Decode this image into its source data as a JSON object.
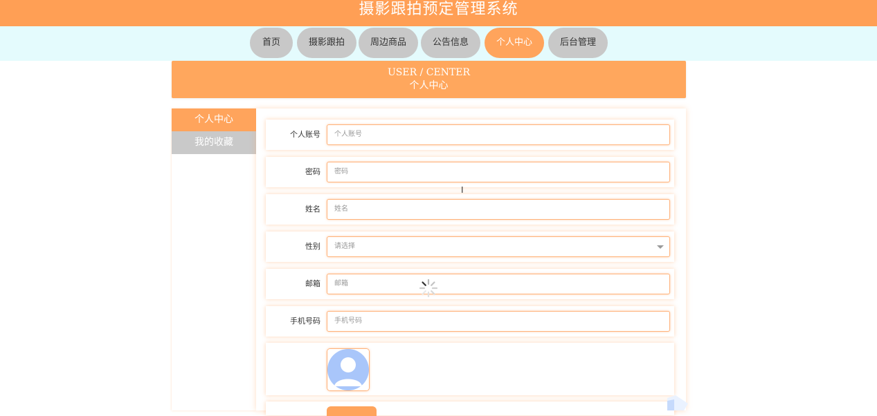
{
  "header": {
    "site_title": "摄影跟拍预定管理系统"
  },
  "nav": {
    "items": [
      {
        "label": "首页",
        "active": false
      },
      {
        "label": "摄影跟拍",
        "active": false
      },
      {
        "label": "周边商品",
        "active": false
      },
      {
        "label": "公告信息",
        "active": false
      },
      {
        "label": "个人中心",
        "active": true
      },
      {
        "label": "后台管理",
        "active": false
      }
    ]
  },
  "banner": {
    "title_en": "USER / CENTER",
    "title_cn": "个人中心"
  },
  "sidebar": {
    "items": [
      {
        "label": "个人中心",
        "active": true
      },
      {
        "label": "我的收藏",
        "active": false
      }
    ]
  },
  "form": {
    "account": {
      "label": "个人账号",
      "placeholder": "个人账号",
      "value": ""
    },
    "password": {
      "label": "密码",
      "placeholder": "密码",
      "value": ""
    },
    "name": {
      "label": "姓名",
      "placeholder": "姓名",
      "value": ""
    },
    "gender": {
      "label": "性别",
      "selected": "请选择"
    },
    "email": {
      "label": "邮箱",
      "placeholder": "邮箱",
      "value": ""
    },
    "phone": {
      "label": "手机号码",
      "placeholder": "手机号码",
      "value": ""
    }
  },
  "colors": {
    "accent": "#ffa45c",
    "header_bg": "#ff9f55",
    "nav_bg": "#e4fbfd",
    "inactive": "#c8c8c8",
    "avatar": "#a9c6fa"
  },
  "icons": {
    "avatar": "user-avatar-icon",
    "spinner": "loading-spinner-icon",
    "cursor": "text-cursor-icon",
    "dropdown": "chevron-down-icon"
  }
}
